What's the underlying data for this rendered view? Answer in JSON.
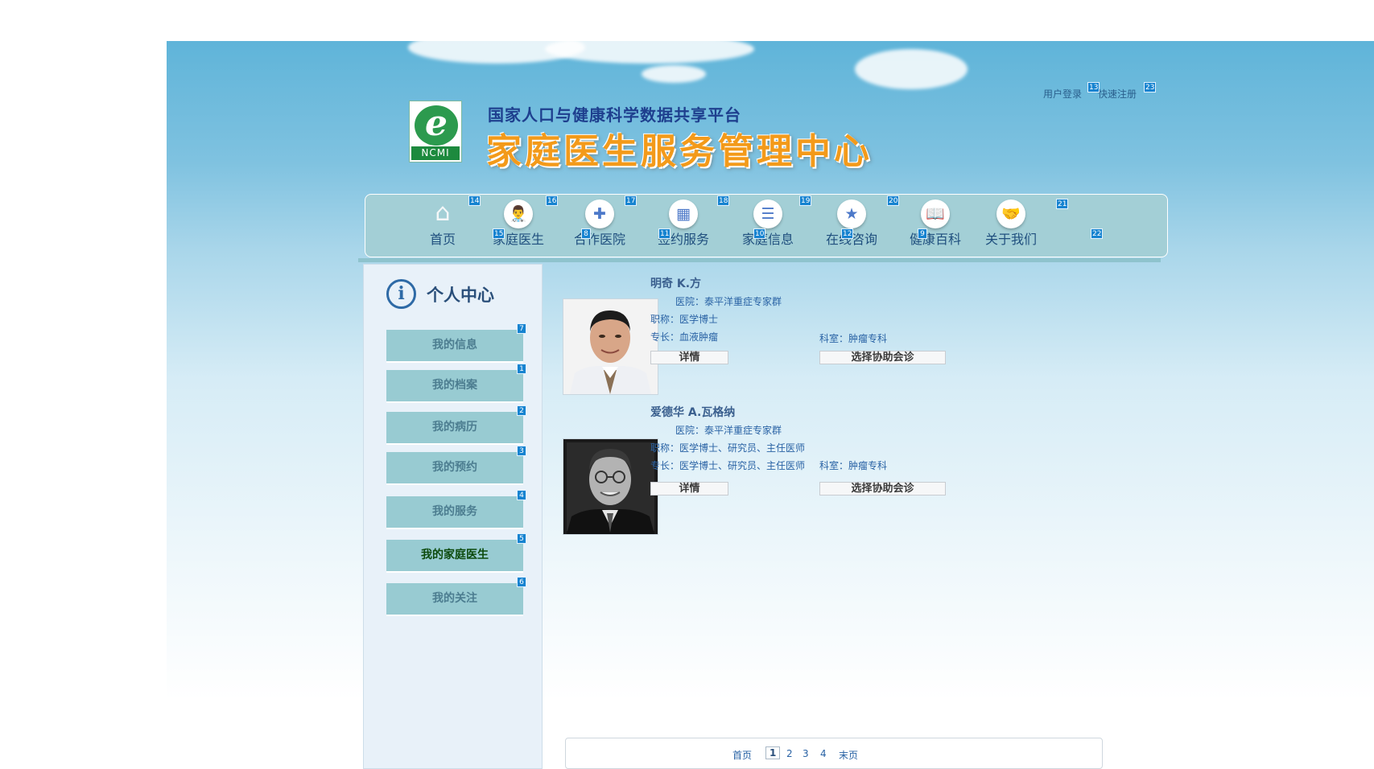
{
  "header": {
    "subtitle": "国家人口与健康科学数据共享平台",
    "title": "家庭医生服务管理中心",
    "logo_text": "NCMI",
    "login_label": "用户登录",
    "register_label": "快速注册"
  },
  "nav": {
    "items": [
      {
        "label": "首页",
        "icon": "home-icon"
      },
      {
        "label": "家庭医生",
        "icon": "doctor-icon"
      },
      {
        "label": "合作医院",
        "icon": "hospital-icon"
      },
      {
        "label": "签约服务",
        "icon": "calendar-icon"
      },
      {
        "label": "家庭信息",
        "icon": "family-info-icon"
      },
      {
        "label": "在线咨询",
        "icon": "consult-icon"
      },
      {
        "label": "健康百科",
        "icon": "book-icon"
      },
      {
        "label": "关于我们",
        "icon": "handshake-icon"
      }
    ]
  },
  "sidebar": {
    "title": "个人中心",
    "items": [
      {
        "label": "我的信息",
        "marker": "7"
      },
      {
        "label": "我的档案",
        "marker": "1"
      },
      {
        "label": "我的病历",
        "marker": "2"
      },
      {
        "label": "我的预约",
        "marker": "3"
      },
      {
        "label": "我的服务",
        "marker": "4"
      },
      {
        "label": "我的家庭医生",
        "marker": "5"
      },
      {
        "label": "我的关注",
        "marker": "6"
      }
    ]
  },
  "doctors": [
    {
      "name": "明奇 K.方",
      "hospital": "医院：泰平洋重症专家群",
      "title": "职称：医学博士",
      "specialty": "专长：血液肿瘤",
      "department": "科室：肿瘤专科",
      "detail_label": "详情",
      "consult_label": "选择协助会诊"
    },
    {
      "name": "爱德华 A.瓦格纳",
      "hospital": "医院：泰平洋重症专家群",
      "title": "职称：医学博士、研究员、主任医师",
      "specialty": "专长：医学博士、研究员、主任医师",
      "department": "科室：肿瘤专科",
      "detail_label": "详情",
      "consult_label": "选择协助会诊"
    }
  ],
  "pager": {
    "first": "首页",
    "pages": [
      "1",
      "2",
      "3",
      "4"
    ],
    "current": "1",
    "last": "末页"
  },
  "markers": {
    "login": "13",
    "register": "23",
    "nav_icons": [
      "14",
      "16",
      "17",
      "18",
      "19",
      "20",
      "21"
    ],
    "nav_gaps": [
      "15",
      "8",
      "11",
      "10",
      "12",
      "9",
      "22"
    ]
  },
  "colors": {
    "accent": "#1683d0",
    "title_orange": "#f39a1a",
    "sidebar_button": "#98cbd2",
    "nav_bar": "#a3cfd6"
  }
}
